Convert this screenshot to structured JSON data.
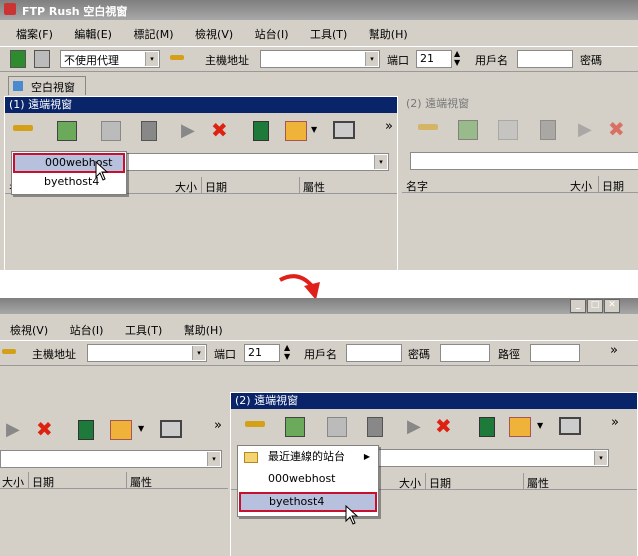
{
  "app_title": "FTP Rush  空白視窗",
  "menu": [
    "檔案(F)",
    "編輯(E)",
    "標記(M)",
    "檢視(V)",
    "站台(I)",
    "工具(T)",
    "幫助(H)"
  ],
  "menu_bottom": [
    "檢視(V)",
    "站台(I)",
    "工具(T)",
    "幫助(H)"
  ],
  "toolbar": {
    "proxy_value": "不使用代理",
    "host_label": "主機地址",
    "port_label": "端口",
    "port_value": "21",
    "user_label": "用戶名",
    "password_label": "密碼",
    "path_label": "路徑"
  },
  "tab_label": "空白視窗",
  "remote1_title": "(1) 遠端視窗",
  "remote2_title": "(2) 遠端視窗",
  "columns": {
    "name": "名字",
    "size": "大小",
    "date": "日期",
    "attr": "屬性"
  },
  "dropdown_top": [
    "000webhost",
    "byethost4"
  ],
  "dropdown_bottom": {
    "recent": "最近連線的站台",
    "items": [
      "000webhost",
      "byethost4"
    ]
  },
  "more_glyph": "»",
  "arrow_glyph": "▾",
  "colors": {
    "active_title": "#0a246a",
    "highlight_border": "#c8102e",
    "transition_arrow": "#e0201a"
  }
}
